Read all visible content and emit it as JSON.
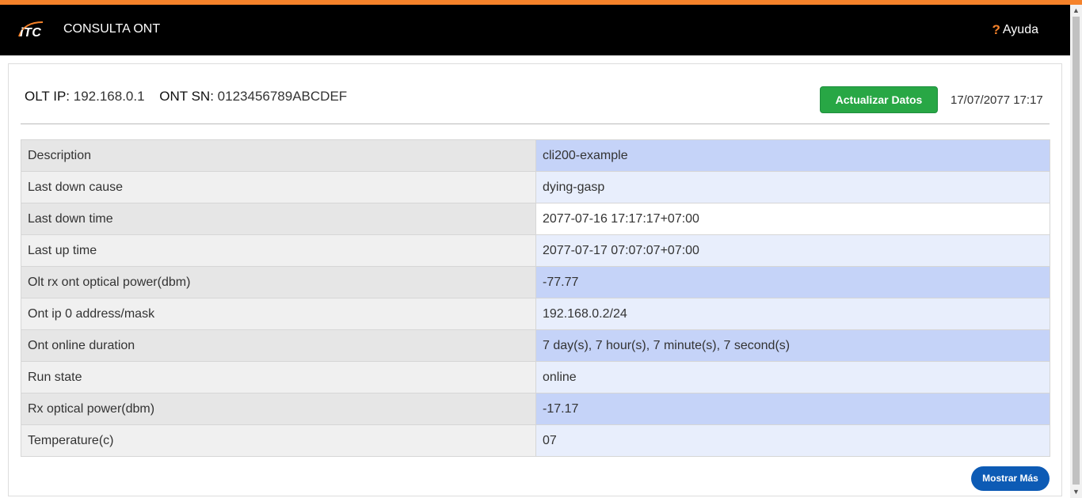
{
  "header": {
    "logo_text": "iTC",
    "title": "CONSULTA ONT",
    "help_icon": "?",
    "help_label": "Ayuda"
  },
  "info": {
    "olt_ip_label": "OLT IP:",
    "olt_ip_value": "192.168.0.1",
    "ont_sn_label": "ONT SN:",
    "ont_sn_value": "0123456789ABCDEF"
  },
  "actions": {
    "update_label": "Actualizar Datos",
    "timestamp": "17/07/2077 17:17",
    "more_label": "Mostrar Más"
  },
  "rows": [
    {
      "key": "Description",
      "value": "cli200-example"
    },
    {
      "key": "Last down cause",
      "value": "dying-gasp"
    },
    {
      "key": "Last down time",
      "value": "2077-07-16 17:17:17+07:00"
    },
    {
      "key": "Last up time",
      "value": "2077-07-17 07:07:07+07:00"
    },
    {
      "key": "Olt rx ont optical power(dbm)",
      "value": "-77.77"
    },
    {
      "key": "Ont ip 0 address/mask",
      "value": "192.168.0.2/24"
    },
    {
      "key": "Ont online duration",
      "value": "7 day(s), 7 hour(s), 7 minute(s), 7 second(s)"
    },
    {
      "key": "Run state",
      "value": "online"
    },
    {
      "key": "Rx optical power(dbm)",
      "value": "-17.17"
    },
    {
      "key": "Temperature(c)",
      "value": "07"
    }
  ],
  "colors": {
    "accent": "#f5822a",
    "update_button": "#28a745",
    "more_button": "#0d5bb5",
    "highlight_cell": "#c5d3f8",
    "value_cell": "#e8eefc"
  },
  "icons": {
    "logo": "itc-logo-icon",
    "help": "question-icon"
  }
}
